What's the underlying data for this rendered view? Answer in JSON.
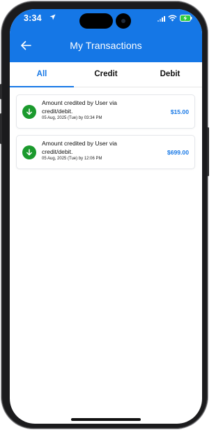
{
  "status_bar": {
    "time": "3:34",
    "icons": [
      "location-arrow-icon",
      "signal-icon",
      "wifi-icon",
      "battery-charging-icon"
    ]
  },
  "header": {
    "title": "My Transactions",
    "back_icon": "arrow-left-icon"
  },
  "tabs": [
    {
      "label": "All",
      "active": true
    },
    {
      "label": "Credit",
      "active": false
    },
    {
      "label": "Debit",
      "active": false
    }
  ],
  "transactions": [
    {
      "description": "Amount credited by User via credit/debit.",
      "date": "05 Aug, 2025 (Tue) by 03:34 PM",
      "amount": "$15.00",
      "icon": "arrow-down-icon"
    },
    {
      "description": "Amount credited by User via credit/debit.",
      "date": "05 Aug, 2025 (Tue) by 12:06 PM",
      "amount": "$699.00",
      "icon": "arrow-down-icon"
    }
  ],
  "colors": {
    "primary": "#1577e6",
    "credit_icon_bg": "#1b9a2d",
    "amount": "#1577e6",
    "frame": "#1b1b1d"
  }
}
